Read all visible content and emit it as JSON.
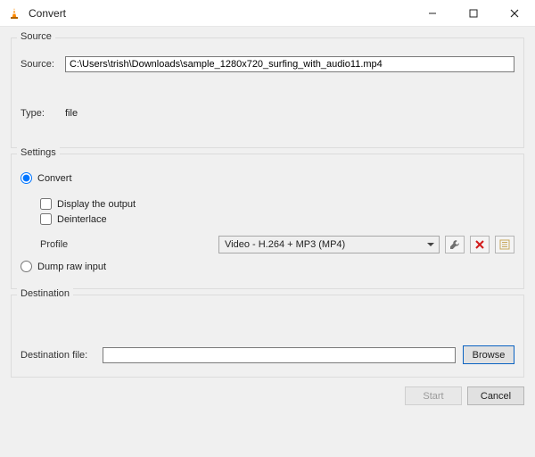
{
  "window": {
    "title": "Convert"
  },
  "source": {
    "group_label": "Source",
    "source_label": "Source:",
    "path": "C:\\Users\\trish\\Downloads\\sample_1280x720_surfing_with_audio11.mp4",
    "type_label": "Type:",
    "type_value": "file"
  },
  "settings": {
    "group_label": "Settings",
    "convert_radio": "Convert",
    "display_output": "Display the output",
    "deinterlace": "Deinterlace",
    "profile_label": "Profile",
    "profile_value": "Video - H.264 + MP3 (MP4)",
    "dump_raw_radio": "Dump raw input"
  },
  "destination": {
    "group_label": "Destination",
    "file_label": "Destination file:",
    "file_value": "",
    "browse": "Browse"
  },
  "footer": {
    "start": "Start",
    "cancel": "Cancel"
  }
}
